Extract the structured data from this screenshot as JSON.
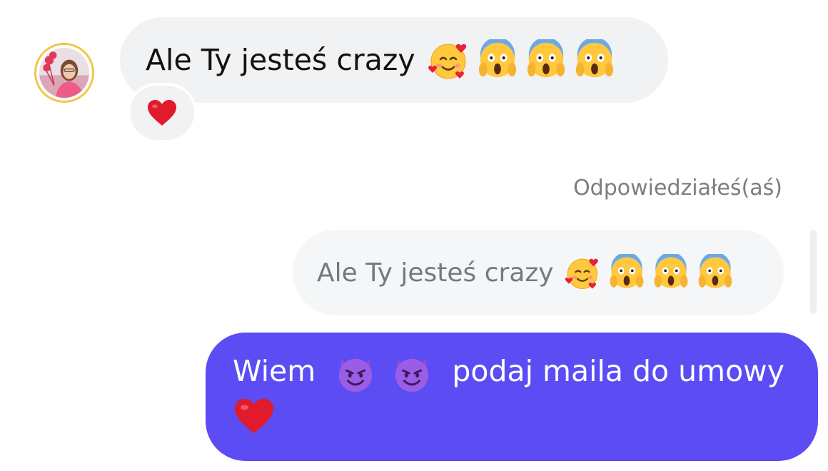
{
  "incoming": {
    "text": "Ale Ty jesteś crazy",
    "emojis": [
      "smiling-face-with-hearts",
      "face-screaming-in-fear",
      "face-screaming-in-fear",
      "face-screaming-in-fear"
    ],
    "reaction": "heart"
  },
  "reply": {
    "label": "Odpowiedziałeś(aś)",
    "quoted_text": "Ale Ty jesteś crazy",
    "quoted_emojis": [
      "smiling-face-with-hearts",
      "face-screaming-in-fear",
      "face-screaming-in-fear",
      "face-screaming-in-fear"
    ]
  },
  "outgoing": {
    "text_before": "Wiem",
    "emojis_mid": [
      "smiling-face-with-horns",
      "smiling-face-with-horns"
    ],
    "text_after": "podaj maila do umowy",
    "emoji_end": "heart"
  },
  "colors": {
    "outgoing_bubble": "#5b4cf3",
    "incoming_bubble": "#f1f2f4",
    "avatar_ring": "#f3c64a",
    "label": "#7a7d82"
  }
}
